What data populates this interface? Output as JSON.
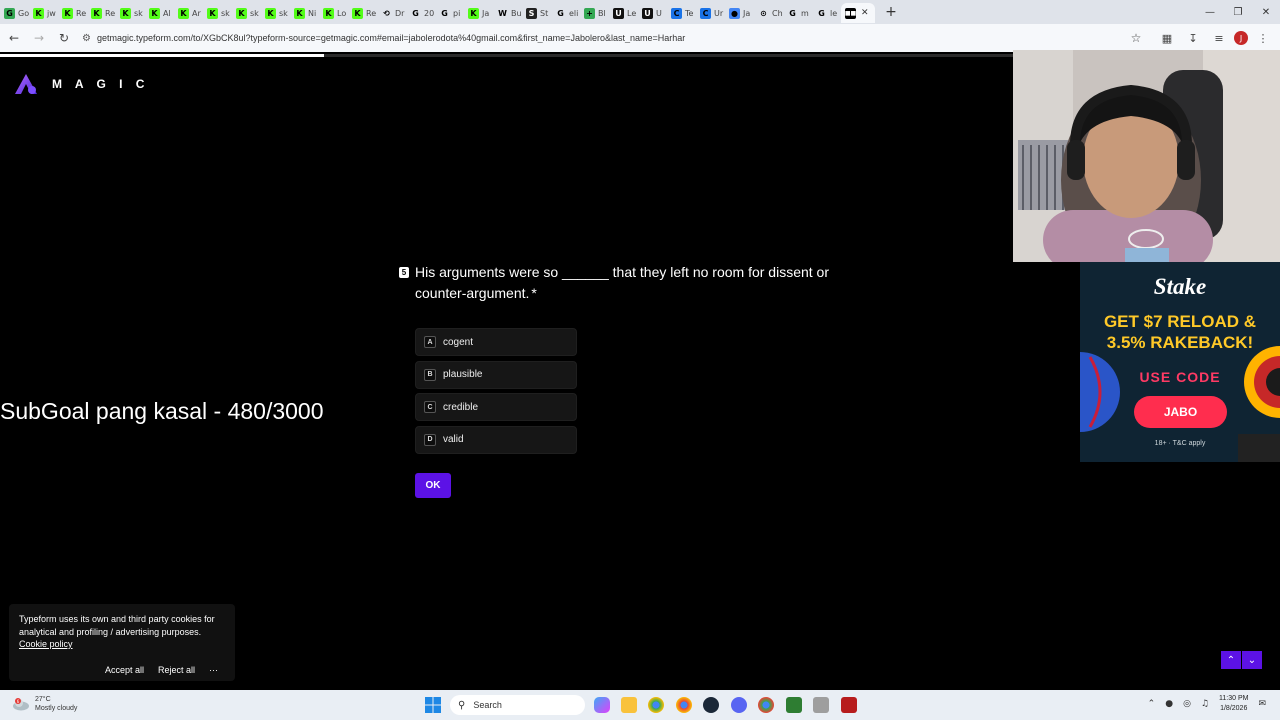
{
  "browser": {
    "tabs": [
      {
        "fav": "G",
        "color": "#34a853",
        "title": "Go"
      },
      {
        "fav": "K",
        "color": "#53fc18",
        "title": "jw"
      },
      {
        "fav": "K",
        "color": "#53fc18",
        "title": "Re"
      },
      {
        "fav": "K",
        "color": "#53fc18",
        "title": "Re"
      },
      {
        "fav": "K",
        "color": "#53fc18",
        "title": "sk"
      },
      {
        "fav": "K",
        "color": "#53fc18",
        "title": "Al"
      },
      {
        "fav": "K",
        "color": "#53fc18",
        "title": "Ar"
      },
      {
        "fav": "K",
        "color": "#53fc18",
        "title": "sk"
      },
      {
        "fav": "K",
        "color": "#53fc18",
        "title": "sk"
      },
      {
        "fav": "K",
        "color": "#53fc18",
        "title": "sk"
      },
      {
        "fav": "K",
        "color": "#53fc18",
        "title": "Ni"
      },
      {
        "fav": "K",
        "color": "#53fc18",
        "title": "Lo"
      },
      {
        "fav": "K",
        "color": "#53fc18",
        "title": "Re"
      },
      {
        "fav": "⟲",
        "color": "#dfe3ea",
        "title": "Dr"
      },
      {
        "fav": "G",
        "color": "#dfe3ea",
        "title": "20"
      },
      {
        "fav": "G",
        "color": "#dfe3ea",
        "title": "pi"
      },
      {
        "fav": "K",
        "color": "#53fc18",
        "title": "Ja"
      },
      {
        "fav": "W",
        "color": "#dfe3ea",
        "title": "Bu"
      },
      {
        "fav": "S",
        "color": "#222222",
        "title": "St"
      },
      {
        "fav": "G",
        "color": "#dfe3ea",
        "title": "eli"
      },
      {
        "fav": "+",
        "color": "#34a853",
        "title": "Bl"
      },
      {
        "fav": "U",
        "color": "#111111",
        "title": "Le"
      },
      {
        "fav": "U",
        "color": "#111111",
        "title": "U"
      },
      {
        "fav": "C",
        "color": "#1a73e8",
        "title": "Te"
      },
      {
        "fav": "C",
        "color": "#1a73e8",
        "title": "Ur"
      },
      {
        "fav": "●",
        "color": "#4285f4",
        "title": "Ja"
      },
      {
        "fav": "⊙",
        "color": "#dfe3ea",
        "title": "Ch"
      },
      {
        "fav": "G",
        "color": "#dfe3ea",
        "title": "m"
      },
      {
        "fav": "G",
        "color": "#dfe3ea",
        "title": "le"
      }
    ],
    "active_tab_icon": "typeform-icon",
    "new_tab_label": "+",
    "url": "getmagic.typeform.com/to/XGbCK8ul?typeform-source=getmagic.com#email=jabolerodota%40gmail.com&first_name=Jabolero&last_name=Harhar",
    "profile_initial": "J"
  },
  "page": {
    "progress": 0.32,
    "logo_text": "M A G I C",
    "overlay_text": "SubGoal pang kasal - 480/3000",
    "question": {
      "number": "5",
      "text": "His arguments were so ______ that they left no room for dissent or counter-argument.",
      "required_mark": "*"
    },
    "choices": [
      {
        "key": "A",
        "label": "cogent"
      },
      {
        "key": "B",
        "label": "plausible"
      },
      {
        "key": "C",
        "label": "credible"
      },
      {
        "key": "D",
        "label": "valid"
      }
    ],
    "ok_label": "OK",
    "cookie": {
      "text": "Typeform uses its own and third party cookies for analytical and profiling / advertising purposes.",
      "policy_link": "Cookie policy",
      "accept": "Accept all",
      "reject": "Reject all",
      "more": "···"
    },
    "accent_color": "#5c12e6"
  },
  "ad": {
    "brand": "Stake",
    "headline_line1": "GET $7 RELOAD &",
    "headline_line2": "3.5% RAKEBACK!",
    "use_code": "USE CODE",
    "code": "JABO",
    "terms": "18+ · T&C apply"
  },
  "taskbar": {
    "temp": "27°C",
    "weather": "Mostly cloudy",
    "weather_badge": "6",
    "search_placeholder": "Search",
    "time": "11:30 PM",
    "date": "1/8/2026"
  }
}
